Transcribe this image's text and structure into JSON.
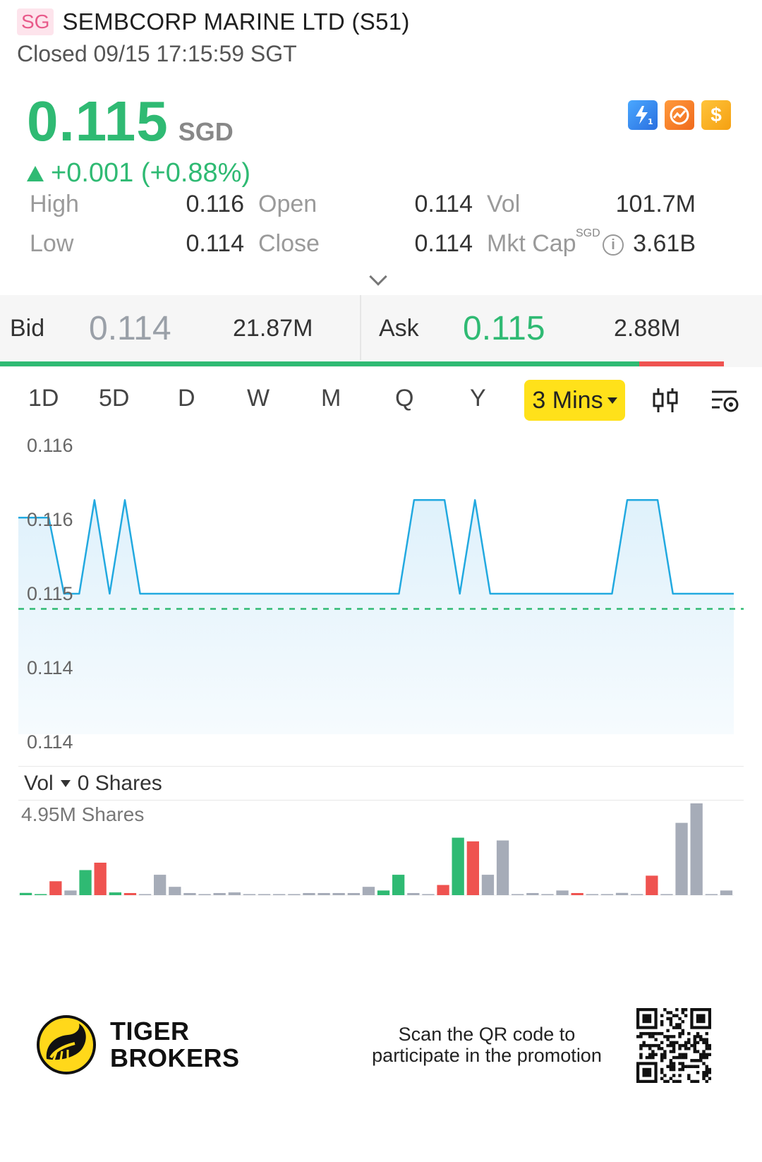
{
  "header": {
    "market": "SG",
    "name": "SEMBCORP MARINE LTD (S51)",
    "status": "Closed 09/15 17:15:59 SGT"
  },
  "quote": {
    "price": "0.115",
    "currency": "SGD",
    "change": "+0.001 (+0.88%)",
    "direction": "up",
    "up_color": "#2fba73",
    "down_color": "#ef5350"
  },
  "badges": [
    {
      "icon": "lightning-level1-icon",
      "color": "#2a6fe0"
    },
    {
      "icon": "no-entry-icon",
      "color": "#f06a1c"
    },
    {
      "icon": "dollar-icon",
      "color": "#f5a012"
    }
  ],
  "stats": {
    "high_label": "High",
    "high": "0.116",
    "low_label": "Low",
    "low": "0.114",
    "open_label": "Open",
    "open": "0.114",
    "close_label": "Close",
    "close": "0.114",
    "vol_label": "Vol",
    "vol": "101.7M",
    "mktcap_label": "Mkt Cap",
    "mktcap_unit": "SGD",
    "mktcap": "3.61B"
  },
  "bidask": {
    "bid_label": "Bid",
    "bid_price": "0.114",
    "bid_size": "21.87M",
    "ask_label": "Ask",
    "ask_price": "0.115",
    "ask_size": "2.88M",
    "bid_ratio": 0.883
  },
  "periods": [
    "1D",
    "5D",
    "D",
    "W",
    "M",
    "Q",
    "Y"
  ],
  "active_period": "3 Mins",
  "volume_panel": {
    "label": "Vol",
    "current": "0 Shares",
    "max": "4.95M Shares"
  },
  "footer": {
    "brand_line1": "TIGER",
    "brand_line2": "BROKERS",
    "promo_line1": "Scan the QR code to",
    "promo_line2": "participate in the promotion"
  },
  "chart_data": [
    {
      "type": "area",
      "y_tick_labels": [
        "0.116",
        "0.116",
        "0.115",
        "0.114",
        "0.114"
      ],
      "ylim": [
        0.1138,
        0.1162
      ],
      "reference_line": 0.11487,
      "x": [
        0,
        1,
        2,
        3,
        4,
        5,
        6,
        7,
        8,
        9,
        10,
        11,
        12,
        13,
        14,
        15,
        16,
        17,
        18,
        19,
        20,
        21,
        22,
        23,
        24,
        25,
        26,
        27,
        28,
        29,
        30,
        31,
        32,
        33,
        34,
        35,
        36,
        37,
        38,
        39,
        40,
        41,
        42,
        43,
        44,
        45,
        46,
        47
      ],
      "values": [
        0.11565,
        0.11565,
        0.11565,
        0.115,
        0.115,
        0.1158,
        0.115,
        0.1158,
        0.115,
        0.115,
        0.115,
        0.115,
        0.115,
        0.115,
        0.115,
        0.115,
        0.115,
        0.115,
        0.115,
        0.115,
        0.115,
        0.115,
        0.115,
        0.115,
        0.115,
        0.115,
        0.1158,
        0.1158,
        0.1158,
        0.115,
        0.1158,
        0.115,
        0.115,
        0.115,
        0.115,
        0.115,
        0.115,
        0.115,
        0.115,
        0.115,
        0.1158,
        0.1158,
        0.1158,
        0.115,
        0.115,
        0.115,
        0.115,
        0.115
      ],
      "line_color": "#22a9e0"
    },
    {
      "type": "bar",
      "series_name": "Vol",
      "ymax_label": "4.95M Shares",
      "ylim": [
        0,
        4.95
      ],
      "values": [
        0.12,
        0,
        0.75,
        0.25,
        1.35,
        1.75,
        0.15,
        0.08,
        0,
        1.1,
        0.45,
        0.05,
        0,
        0.05,
        0.15,
        0,
        0,
        0,
        0,
        0.1,
        0.05,
        0.05,
        0.05,
        0.45,
        0.25,
        1.1,
        0.05,
        0,
        0.55,
        3.1,
        2.9,
        1.1,
        2.95,
        0,
        0.1,
        0,
        0.25,
        0.08,
        0,
        0,
        0.12,
        0,
        1.05,
        0,
        3.9,
        4.95,
        0,
        0.25
      ],
      "colors": [
        "g",
        "g",
        "r",
        "n",
        "g",
        "r",
        "g",
        "r",
        "n",
        "n",
        "n",
        "n",
        "n",
        "n",
        "n",
        "n",
        "n",
        "n",
        "n",
        "n",
        "n",
        "n",
        "n",
        "n",
        "g",
        "g",
        "n",
        "n",
        "r",
        "g",
        "r",
        "n",
        "n",
        "n",
        "n",
        "n",
        "n",
        "r",
        "n",
        "n",
        "n",
        "n",
        "r",
        "n",
        "n",
        "n",
        "n",
        "n"
      ]
    }
  ]
}
